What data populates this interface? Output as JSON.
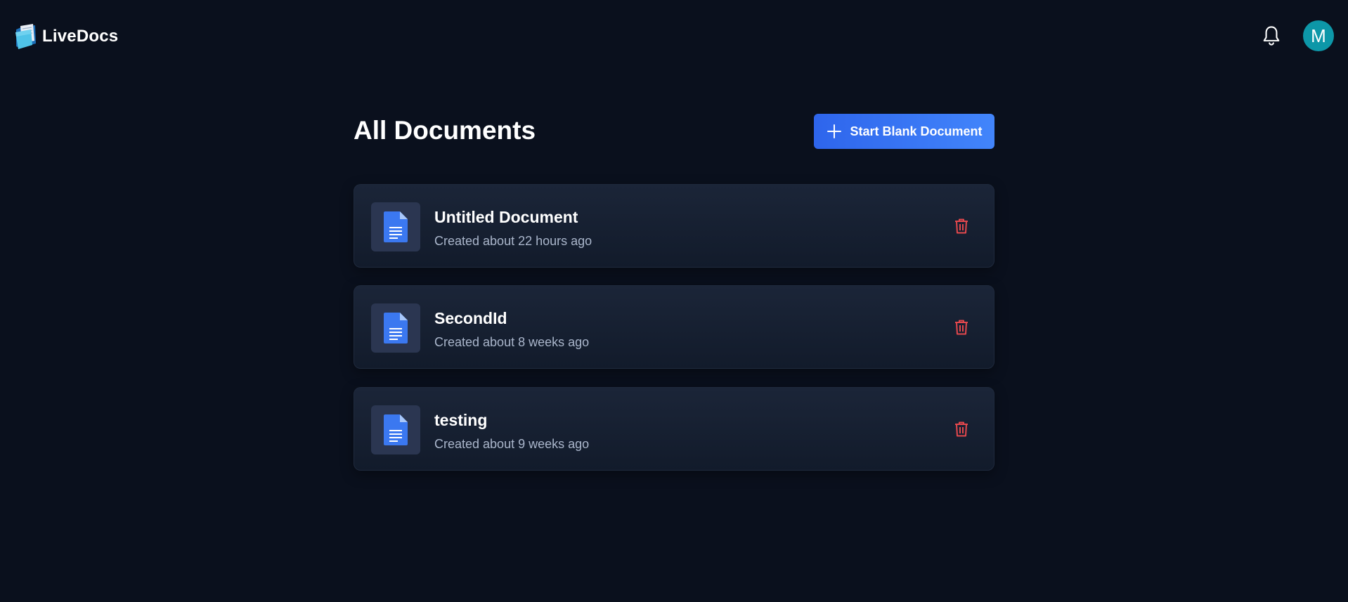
{
  "header": {
    "app_name": "LiveDocs",
    "logo_icon": "folder-document-logo-icon",
    "notification_icon": "bell-icon",
    "avatar_initial": "M",
    "avatar_color": "#0d97a8"
  },
  "main": {
    "title": "All Documents",
    "start_button_label": "Start Blank Document",
    "start_button_icon": "plus-icon",
    "documents": [
      {
        "title": "Untitled Document",
        "meta": "Created about 22 hours ago",
        "icon": "document-icon",
        "delete_icon": "trash-icon"
      },
      {
        "title": "SecondId",
        "meta": "Created about 8 weeks ago",
        "icon": "document-icon",
        "delete_icon": "trash-icon"
      },
      {
        "title": "testing",
        "meta": "Created about 9 weeks ago",
        "icon": "document-icon",
        "delete_icon": "trash-icon"
      }
    ]
  },
  "colors": {
    "background": "#0a101d",
    "accent": "#3b7af5",
    "card": "#172032",
    "delete": "#e5484d",
    "doc_icon": "#3b78f0"
  }
}
